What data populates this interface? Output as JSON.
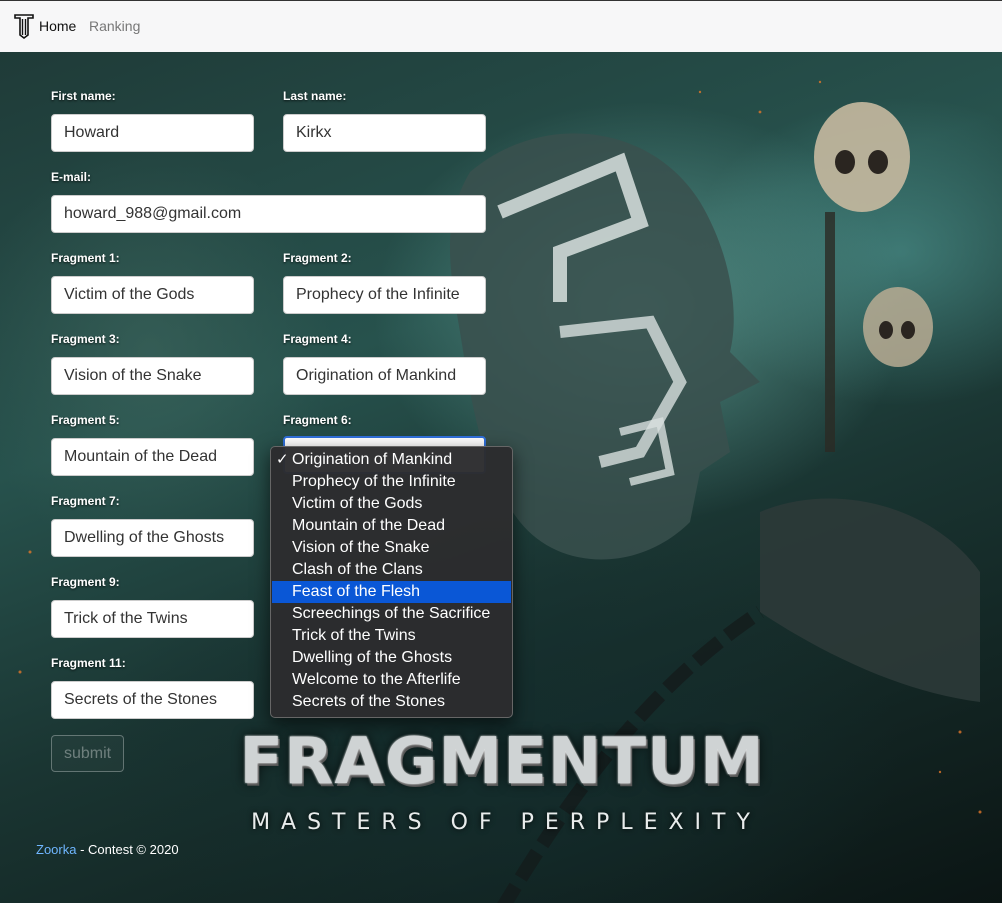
{
  "nav": {
    "home": "Home",
    "ranking": "Ranking"
  },
  "form": {
    "first_name": {
      "label": "First name:",
      "value": "Howard"
    },
    "last_name": {
      "label": "Last name:",
      "value": "Kirkx"
    },
    "email": {
      "label": "E-mail:",
      "value": "howard_988@gmail.com"
    },
    "fragments": [
      {
        "label": "Fragment 1:",
        "value": "Victim of the Gods"
      },
      {
        "label": "Fragment 2:",
        "value": "Prophecy of the Infinite"
      },
      {
        "label": "Fragment 3:",
        "value": "Vision of the Snake"
      },
      {
        "label": "Fragment 4:",
        "value": "Origination of Mankind"
      },
      {
        "label": "Fragment 5:",
        "value": "Mountain of the Dead"
      },
      {
        "label": "Fragment 6:",
        "value": ""
      },
      {
        "label": "Fragment 7:",
        "value": "Dwelling of the Ghosts"
      },
      {
        "label": "Fragment 9:",
        "value": "Trick of the Twins"
      },
      {
        "label": "Fragment 11:",
        "value": "Secrets of the Stones"
      }
    ],
    "submit_label": "submit"
  },
  "dropdown": {
    "options": [
      "Origination of Mankind",
      "Prophecy of the Infinite",
      "Victim of the Gods",
      "Mountain of the Dead",
      "Vision of the Snake",
      "Clash of the Clans",
      "Feast of the Flesh",
      "Screechings of the Sacrifice",
      "Trick of the Twins",
      "Dwelling of the Ghosts",
      "Welcome to the Afterlife",
      "Secrets of the Stones"
    ],
    "checked_option": "Origination of Mankind",
    "highlighted_option": "Feast of the Flesh",
    "check_mark": "✓"
  },
  "brand": {
    "title": "FRAGMENTUM",
    "tagline": "MASTERS OF PERPLEXITY"
  },
  "footer": {
    "link_text": "Zoorka",
    "text": " - Contest © 2020"
  },
  "colors": {
    "accent": "#0a57d6",
    "link": "#6fb6ff",
    "focus": "#2f6fdb"
  }
}
